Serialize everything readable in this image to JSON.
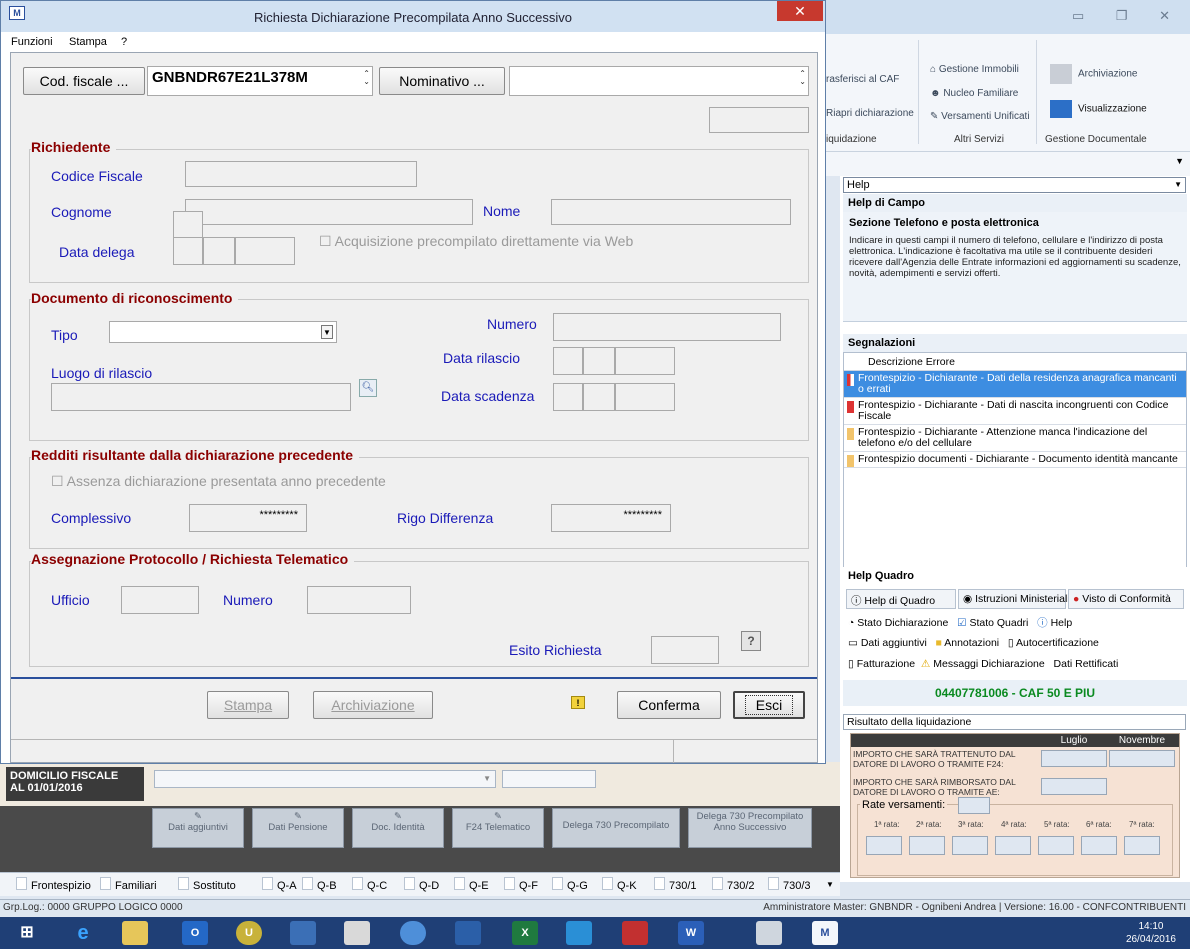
{
  "background": {
    "ribbon": {
      "col1": [
        "rasferisci al CAF",
        "Riapri dichiarazione",
        "iquidazione"
      ],
      "altri_servizi": {
        "items": [
          "Gestione Immobili",
          "Nucleo Familiare",
          "Versamenti Unificati"
        ],
        "group": "Altri Servizi"
      },
      "gestione_documentale": {
        "items": [
          "Archiviazione",
          "Visualizzazione"
        ],
        "group": "Gestione Documentale"
      }
    },
    "help": {
      "select_value": "Help",
      "title": "Help di Campo",
      "section": "Sezione Telefono e posta elettronica",
      "text": "Indicare in questi campi il numero di telefono, cellulare e l'indirizzo di posta elettronica. L'indicazione è facoltativa ma utile se il contribuente desideri ricevere dall'Agenzia delle Entrate informazioni ed aggiornamenti su scadenze, novità, adempimenti e servizi offerti."
    },
    "segnalazioni": {
      "title": "Segnalazioni",
      "column": "Descrizione Errore",
      "rows": [
        "Frontespizio - Dichiarante - Dati della residenza anagrafica mancanti o errati",
        "Frontespizio - Dichiarante - Dati di nascita incongruenti con Codice Fiscale",
        "Frontespizio - Dichiarante - Attenzione manca l'indicazione del telefono e/o del cellulare",
        "Frontespizio documenti - Dichiarante - Documento identità mancante"
      ]
    },
    "help_quadro": {
      "title": "Help Quadro",
      "buttons": [
        "Help di Quadro",
        "Istruzioni Ministeriali",
        "Visto di Conformità"
      ],
      "line1": [
        "Stato Dichiarazione",
        "Stato Quadri",
        "Help"
      ],
      "line2": [
        "Dati aggiuntivi",
        "Annotazioni",
        "Autocertificazione"
      ],
      "line3": [
        "Fatturazione",
        "Messaggi Dichiarazione",
        "Dati Rettificati"
      ]
    },
    "caf": "04407781006 - CAF 50 E PIU",
    "liquidazione": {
      "title": "Risultato della liquidazione",
      "headers": [
        "Luglio",
        "Novembre"
      ],
      "row1": "IMPORTO CHE SARÀ TRATTENUTO DAL DATORE DI LAVORO O TRAMITE F24:",
      "row2": "IMPORTO CHE SARÀ RIMBORSATO DAL DATORE DI LAVORO O TRAMITE AE:",
      "rate_label": "Rate versamenti:",
      "rates": [
        "1ª rata:",
        "2ª rata:",
        "3ª rata:",
        "4ª rata:",
        "5ª rata:",
        "6ª rata:",
        "7ª rata:"
      ]
    },
    "domicilio": "DOMICILIO FISCALE AL 01/01/2016",
    "domicilio_l1": "DOMICILIO FISCALE",
    "domicilio_l2": "AL 01/01/2016",
    "bottom_buttons": [
      "Dati aggiuntivi",
      "Dati Pensione",
      "Doc. Identità",
      "F24 Telematico",
      "Delega 730 Precompilato",
      "Delega 730 Precompilato Anno Successivo"
    ],
    "tabs": [
      "Frontespizio",
      "Familiari",
      "Sostituto",
      "Q-A",
      "Q-B",
      "Q-C",
      "Q-D",
      "Q-E",
      "Q-F",
      "Q-G",
      "Q-K",
      "730/1",
      "730/2",
      "730/3"
    ],
    "status_left": "Grp.Log.: 0000 GRUPPO LOGICO 0000",
    "status_right": "Amministratore Master: GNBNDR - Ognibeni Andrea  |  Versione: 16.00 - CONFCONTRIBUENTI",
    "clock_time": "14:10",
    "clock_date": "26/04/2016"
  },
  "dialog": {
    "title": "Richiesta Dichiarazione Precompilata Anno Successivo",
    "menu": [
      "Funzioni",
      "Stampa",
      "?"
    ],
    "cf_button": "Cod. fiscale ...",
    "cf_value": "GNBNDR67E21L378M",
    "nominativo_button": "Nominativo ...",
    "nominativo_value": "",
    "richiedente": {
      "title": "Richiedente",
      "codice_fiscale": "Codice Fiscale",
      "cognome": "Cognome",
      "nome": "Nome",
      "data_delega": "Data delega",
      "acquisizione": "Acquisizione precompilato direttamente via Web"
    },
    "documento": {
      "title": "Documento di riconoscimento",
      "tipo": "Tipo",
      "numero": "Numero",
      "data_rilascio": "Data rilascio",
      "luogo_rilascio": "Luogo di rilascio",
      "data_scadenza": "Data scadenza"
    },
    "redditi": {
      "title": "Redditi risultante dalla dichiarazione precedente",
      "assenza": "Assenza dichiarazione presentata anno precedente",
      "complessivo": "Complessivo",
      "complessivo_value": "*********",
      "rigo_differenza": "Rigo Differenza",
      "rigo_value": "*********"
    },
    "protocollo": {
      "title": "Assegnazione Protocollo / Richiesta Telematico",
      "ufficio": "Ufficio",
      "numero": "Numero",
      "esito": "Esito Richiesta",
      "help_glyph": "?"
    },
    "buttons": {
      "stampa": "Stampa",
      "archiviazione": "Archiviazione",
      "conferma": "Conferma",
      "esci": "Esci"
    },
    "colors": {
      "section_title": "#8b0000",
      "label": "#1a1ab8",
      "close": "#c7392e",
      "accent": "#2a4f9c"
    }
  }
}
